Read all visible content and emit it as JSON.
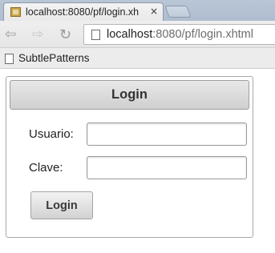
{
  "browser": {
    "tab_title": "localhost:8080/pf/login.xh",
    "close_glyph": "×",
    "nav": {
      "back": "⇦",
      "forward": "⇨",
      "reload": "↻"
    },
    "url_host": "localhost",
    "url_rest": ":8080/pf/login.xhtml",
    "bookmark": "SubtlePatterns"
  },
  "login": {
    "header": "Login",
    "username_label": "Usuario:",
    "username_value": "",
    "password_label": "Clave:",
    "password_value": "",
    "submit_label": "Login"
  }
}
